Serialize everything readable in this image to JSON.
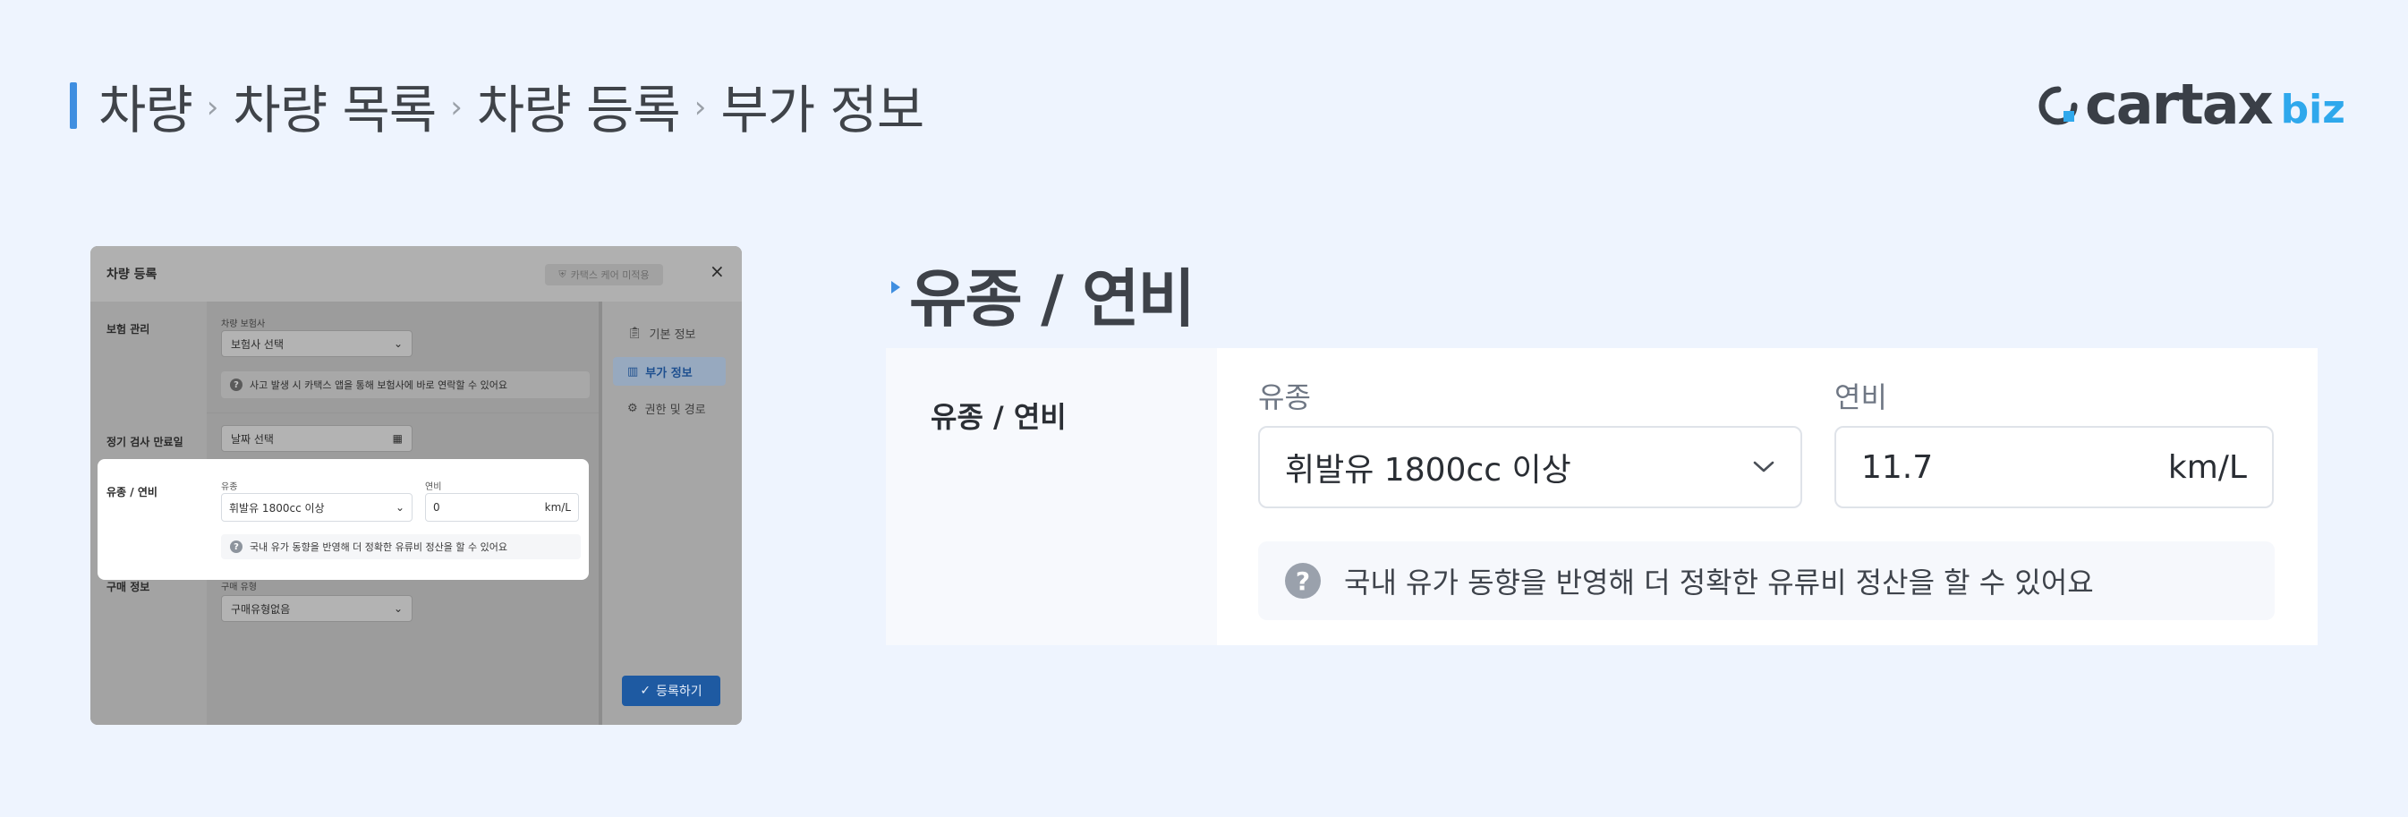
{
  "breadcrumb": {
    "items": [
      "차량",
      "차량 목록",
      "차량 등록",
      "부가 정보"
    ],
    "separator": "›"
  },
  "logo": {
    "name": "cartax",
    "suffix": "biz",
    "accent_color": "#2fa8ec"
  },
  "modal": {
    "title": "차량 등록",
    "chip": "카택스 케어 미적용",
    "close": "×",
    "insurance": {
      "label": "보험 관리",
      "sublabel": "차량 보험사",
      "select_value": "보험사 선택",
      "info": "사고 발생 시 카택스 앱을 통해 보험사에 바로 연락할 수 있어요"
    },
    "inspection": {
      "label": "정기 검사 만료일",
      "date_placeholder": "날짜 선택"
    },
    "fuel": {
      "label": "유종 / 연비",
      "fuel_type_label": "유종",
      "fuel_type_value": "휘발유 1800cc 이상",
      "efficiency_label": "연비",
      "efficiency_value": "0",
      "efficiency_unit": "km/L",
      "info": "국내 유가 동향을 반영해 더 정확한 유류비 정산을 할 수 있어요"
    },
    "purchase": {
      "label": "구매 정보",
      "sublabel": "구매 유형",
      "select_value": "구매유형없음"
    },
    "nav": {
      "basic": "기본 정보",
      "extra": "부가 정보",
      "permissions": "권한 및 경로"
    },
    "submit": "등록하기"
  },
  "detail": {
    "title": "유종 / 연비",
    "row_label": "유종 / 연비",
    "fuel_type_label": "유종",
    "fuel_type_value": "휘발유 1800cc 이상",
    "efficiency_label": "연비",
    "efficiency_value": "11.7",
    "efficiency_unit": "km/L",
    "info": "국내 유가 동향을 반영해 더 정확한 유류비 정산을 할 수 있어요"
  }
}
